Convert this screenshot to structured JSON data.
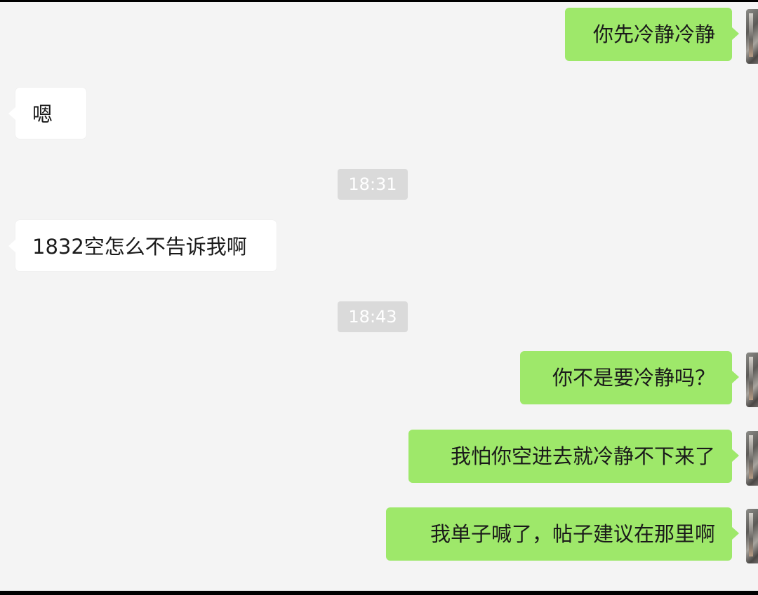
{
  "messages": [
    {
      "side": "out",
      "text": "你先冷静冷静"
    },
    {
      "side": "in",
      "text": "嗯"
    },
    {
      "side": "in",
      "text": "1832空怎么不告诉我啊"
    },
    {
      "side": "out",
      "text": "你不是要冷静吗？"
    },
    {
      "side": "out",
      "text": "我怕你空进去就冷静不下来了"
    },
    {
      "side": "out",
      "text": "我单子喊了，帖子建议在那里啊"
    }
  ],
  "timestamps": [
    "18:31",
    "18:43"
  ],
  "colors": {
    "background": "#f4f4f4",
    "outgoing_bubble": "#9ee86a",
    "incoming_bubble": "#ffffff",
    "timestamp_pill": "#dadada"
  }
}
